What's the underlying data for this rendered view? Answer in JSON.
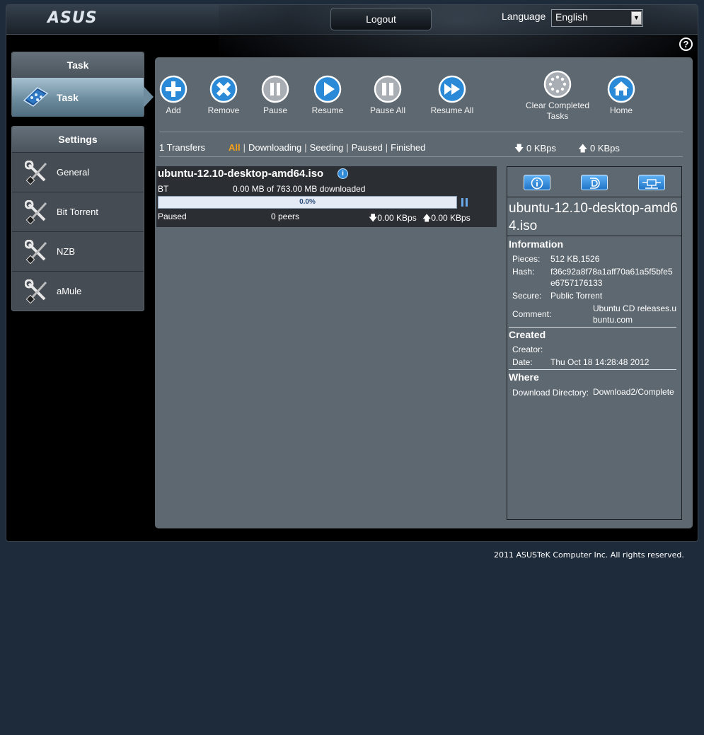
{
  "header": {
    "logo": "ASUS",
    "logout_label": "Logout",
    "language_label": "Language",
    "language_value": "English",
    "help_symbol": "?"
  },
  "sidebar": {
    "task_section_title": "Task",
    "task_item_label": "Task",
    "settings_section_title": "Settings",
    "settings_items": [
      {
        "label": "General",
        "icon": "wrench-screwdriver-icon"
      },
      {
        "label": "Bit Torrent",
        "icon": "wrench-screwdriver-icon"
      },
      {
        "label": "NZB",
        "icon": "wrench-screwdriver-icon"
      },
      {
        "label": "aMule",
        "icon": "wrench-screwdriver-icon"
      }
    ]
  },
  "toolbar": {
    "add": "Add",
    "remove": "Remove",
    "pause": "Pause",
    "resume": "Resume",
    "pause_all": "Pause All",
    "resume_all": "Resume All",
    "clear_completed_line1": "Clear Completed",
    "clear_completed_line2": "Tasks",
    "home": "Home"
  },
  "filter_bar": {
    "transfers": "1 Transfers",
    "filters": [
      "All",
      "Downloading",
      "Seeding",
      "Paused",
      "Finished"
    ],
    "active_filter": "All",
    "download_speed": "0 KBps",
    "upload_speed": "0 KBps"
  },
  "task": {
    "name": "ubuntu-12.10-desktop-amd64.iso",
    "type": "BT",
    "downloaded": "0.00 MB of 763.00 MB downloaded",
    "progress_percent": 0.0,
    "progress_text": "0.0%",
    "status": "Paused",
    "peers": "0 peers",
    "download_speed": "0.00 KBps",
    "upload_speed": "0.00 KBps"
  },
  "detail": {
    "title": "ubuntu-12.10-desktop-amd64.iso",
    "information_title": "Information",
    "pieces_label": "Pieces:",
    "pieces_value": "512 KB,1526",
    "hash_label": "Hash:",
    "hash_value": "f36c92a8f78a1aff70a61a5f5bfe5e6757176133",
    "secure_label": "Secure:",
    "secure_value": "Public Torrent",
    "comment_label": "Comment:",
    "comment_value": "Ubuntu CD releases.ubuntu.com",
    "created_title": "Created",
    "creator_label": "Creator:",
    "creator_value": "",
    "date_label": "Date:",
    "date_value": "Thu Oct 18 14:28:48 2012",
    "where_title": "Where",
    "directory_label": "Download Directory:",
    "directory_value": "Download2/Complete"
  },
  "colors": {
    "accent_active_filter": "#f6a01a",
    "toolbar_button_blue": "#2a8ad8",
    "toolbar_button_gray": "#a8aeb4",
    "panel_bg": "#5e6870",
    "page_bg": "#1e2b3b"
  },
  "footer": {
    "copyright": "2011 ASUSTeK Computer Inc. All rights reserved."
  }
}
